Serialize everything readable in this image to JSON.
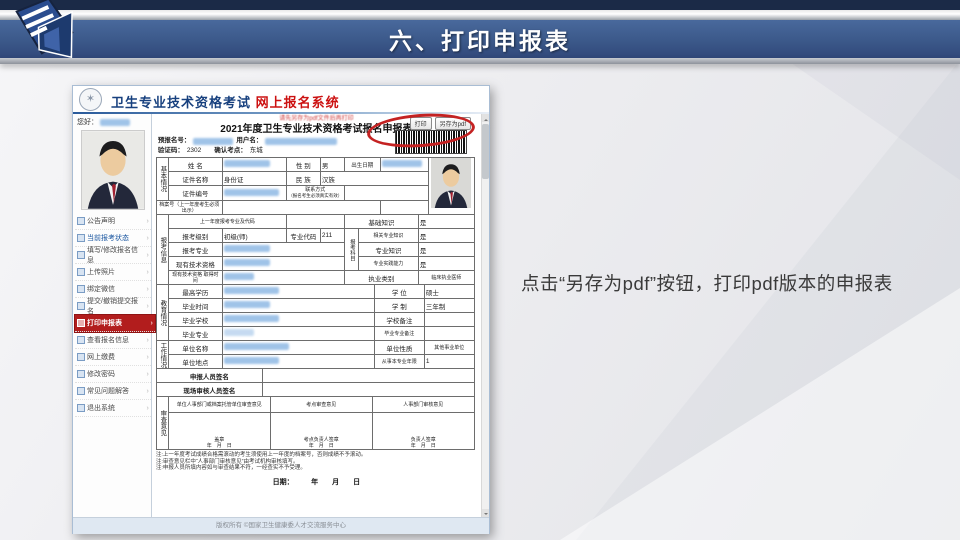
{
  "slide": {
    "header_title": "六、打印申报表",
    "caption": "点击“另存为pdf”按钮，打印pdf版本的申报表"
  },
  "app": {
    "brand_main": "卫生专业技术资格考试",
    "brand_sub": "网上报名系统",
    "logo_glyph": "✶",
    "greeting": "您好：",
    "footer": "版权所有 ©国家卫生健康委人才交流服务中心",
    "sidebar": [
      {
        "label": "公告声明"
      },
      {
        "label": "当前报考状态"
      },
      {
        "label": "填写/修改报名信息"
      },
      {
        "label": "上传照片"
      },
      {
        "label": "绑定微信"
      },
      {
        "label": "提交/撤销提交报名"
      },
      {
        "label": "打印申报表"
      },
      {
        "label": "查看报名信息"
      },
      {
        "label": "网上缴费"
      },
      {
        "label": "修改密码"
      },
      {
        "label": "常见问题解答"
      },
      {
        "label": "退出系统"
      }
    ]
  },
  "form": {
    "hint": "请先另存为pdf文件后再打印",
    "title": "2021年度卫生专业技术资格考试报名申报表",
    "print_btn": "打印",
    "save_pdf_btn": "另存为pdf",
    "prereg_label": "预报名号：",
    "username_label": "用户名：",
    "verify_label": "验证码：",
    "verify_value": "2302",
    "confirm_label": "确认考点：",
    "confirm_value": "东城",
    "sections": {
      "basic": "基本情况",
      "apply": "报考信息",
      "edu": "教育情况",
      "work": "工作情况",
      "review": "审查意见",
      "subjects": "报考科目"
    },
    "f": {
      "name": "姓  名",
      "gender": "性 别",
      "gender_v": "男",
      "birth": "出生日期",
      "cert": "证件名称",
      "cert_v": "身份证",
      "ethnic": "民 族",
      "ethnic_v": "汉族",
      "certno": "证件编号",
      "contact": "联系方式",
      "contact_note": "（报名考生必须真实有效）",
      "archive": "档案号（上一年度考生必须出示）",
      "lastmajor": "上一年度报考专业及代码",
      "level": "报考级别",
      "level_v": "初级(师)",
      "code": "专业代码",
      "code_v": "211",
      "major": "报考专业",
      "qual": "现有技术资格",
      "qualtime": "现有技术资格 取得时间",
      "practype": "执业类别",
      "practype_v": "临床执业医师",
      "s1": "基础知识",
      "s2": "相关专业知识",
      "s3": "专业知识",
      "s4": "专业实践能力",
      "sv": "是",
      "edu_top": "最高学历",
      "degree": "学 位",
      "degree_v": "硕士",
      "gradtime": "毕业时间",
      "schooling": "学 制",
      "schooling_v": "三年制",
      "school": "毕业学校",
      "school_note": "学校备注",
      "gradmajor": "毕业专业",
      "gradmajor_note": "毕业专业备注",
      "unit": "单位名称",
      "unit_type": "单位性质",
      "unit_type_v": "其他事业单位",
      "unit_addr": "单位地点",
      "years": "从事本专业年限",
      "years_v": "1",
      "sign1": "申报人员签名",
      "sign2": "现场审核人员签名",
      "rv1": "单位人事部门或档案托管单位审查意见",
      "rv2": "考点审查意见",
      "rv3": "人事部门审核意见",
      "stamp1": "盖章",
      "stamp2": "考点负责人签章",
      "stamp3": "负责人签章",
      "ymd": "年　月　日"
    },
    "notes": [
      "注:上一年度考试成绩合格需滚动的考生须使用上一年度的档案号，否则成绩不予滚动。",
      "注:审查意见栏中“人事部门审核意见”由考试机构审核填写。",
      "注:申报人员所填内容如与审查结果不符，一经查实不予受理。"
    ],
    "date_line": "日期：　　　年　　月　　日"
  }
}
